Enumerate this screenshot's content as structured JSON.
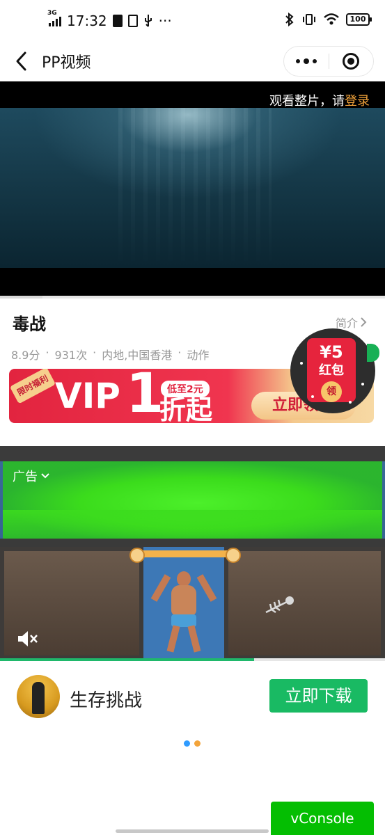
{
  "status_bar": {
    "network": "3G",
    "time": "17:32",
    "extra": "···",
    "battery": "100"
  },
  "nav": {
    "title": "PP视频"
  },
  "video": {
    "login_prefix": "观看整片，请",
    "login_link": "登录",
    "progress_percent": 11
  },
  "movie": {
    "title": "毒战",
    "intro_label": "简介",
    "score": "8.9分",
    "plays": "931次",
    "region": "内地,中国香港",
    "genre": "动作"
  },
  "vip_banner": {
    "ribbon": "限时福利",
    "vip_text": "VIP",
    "vip_number": "1",
    "tag": "低至2元",
    "fold": "折起",
    "cta": "立即领取"
  },
  "red_packet": {
    "amount": "¥5",
    "label": "红包",
    "button": "领"
  },
  "ad": {
    "label": "广告",
    "progress_percent": 66,
    "app_name": "生存挑战",
    "download_label": "立即下载"
  },
  "pager": {
    "colors": [
      "#2f9bff",
      "#f3a43b"
    ]
  },
  "vconsole": {
    "label": "vConsole"
  }
}
